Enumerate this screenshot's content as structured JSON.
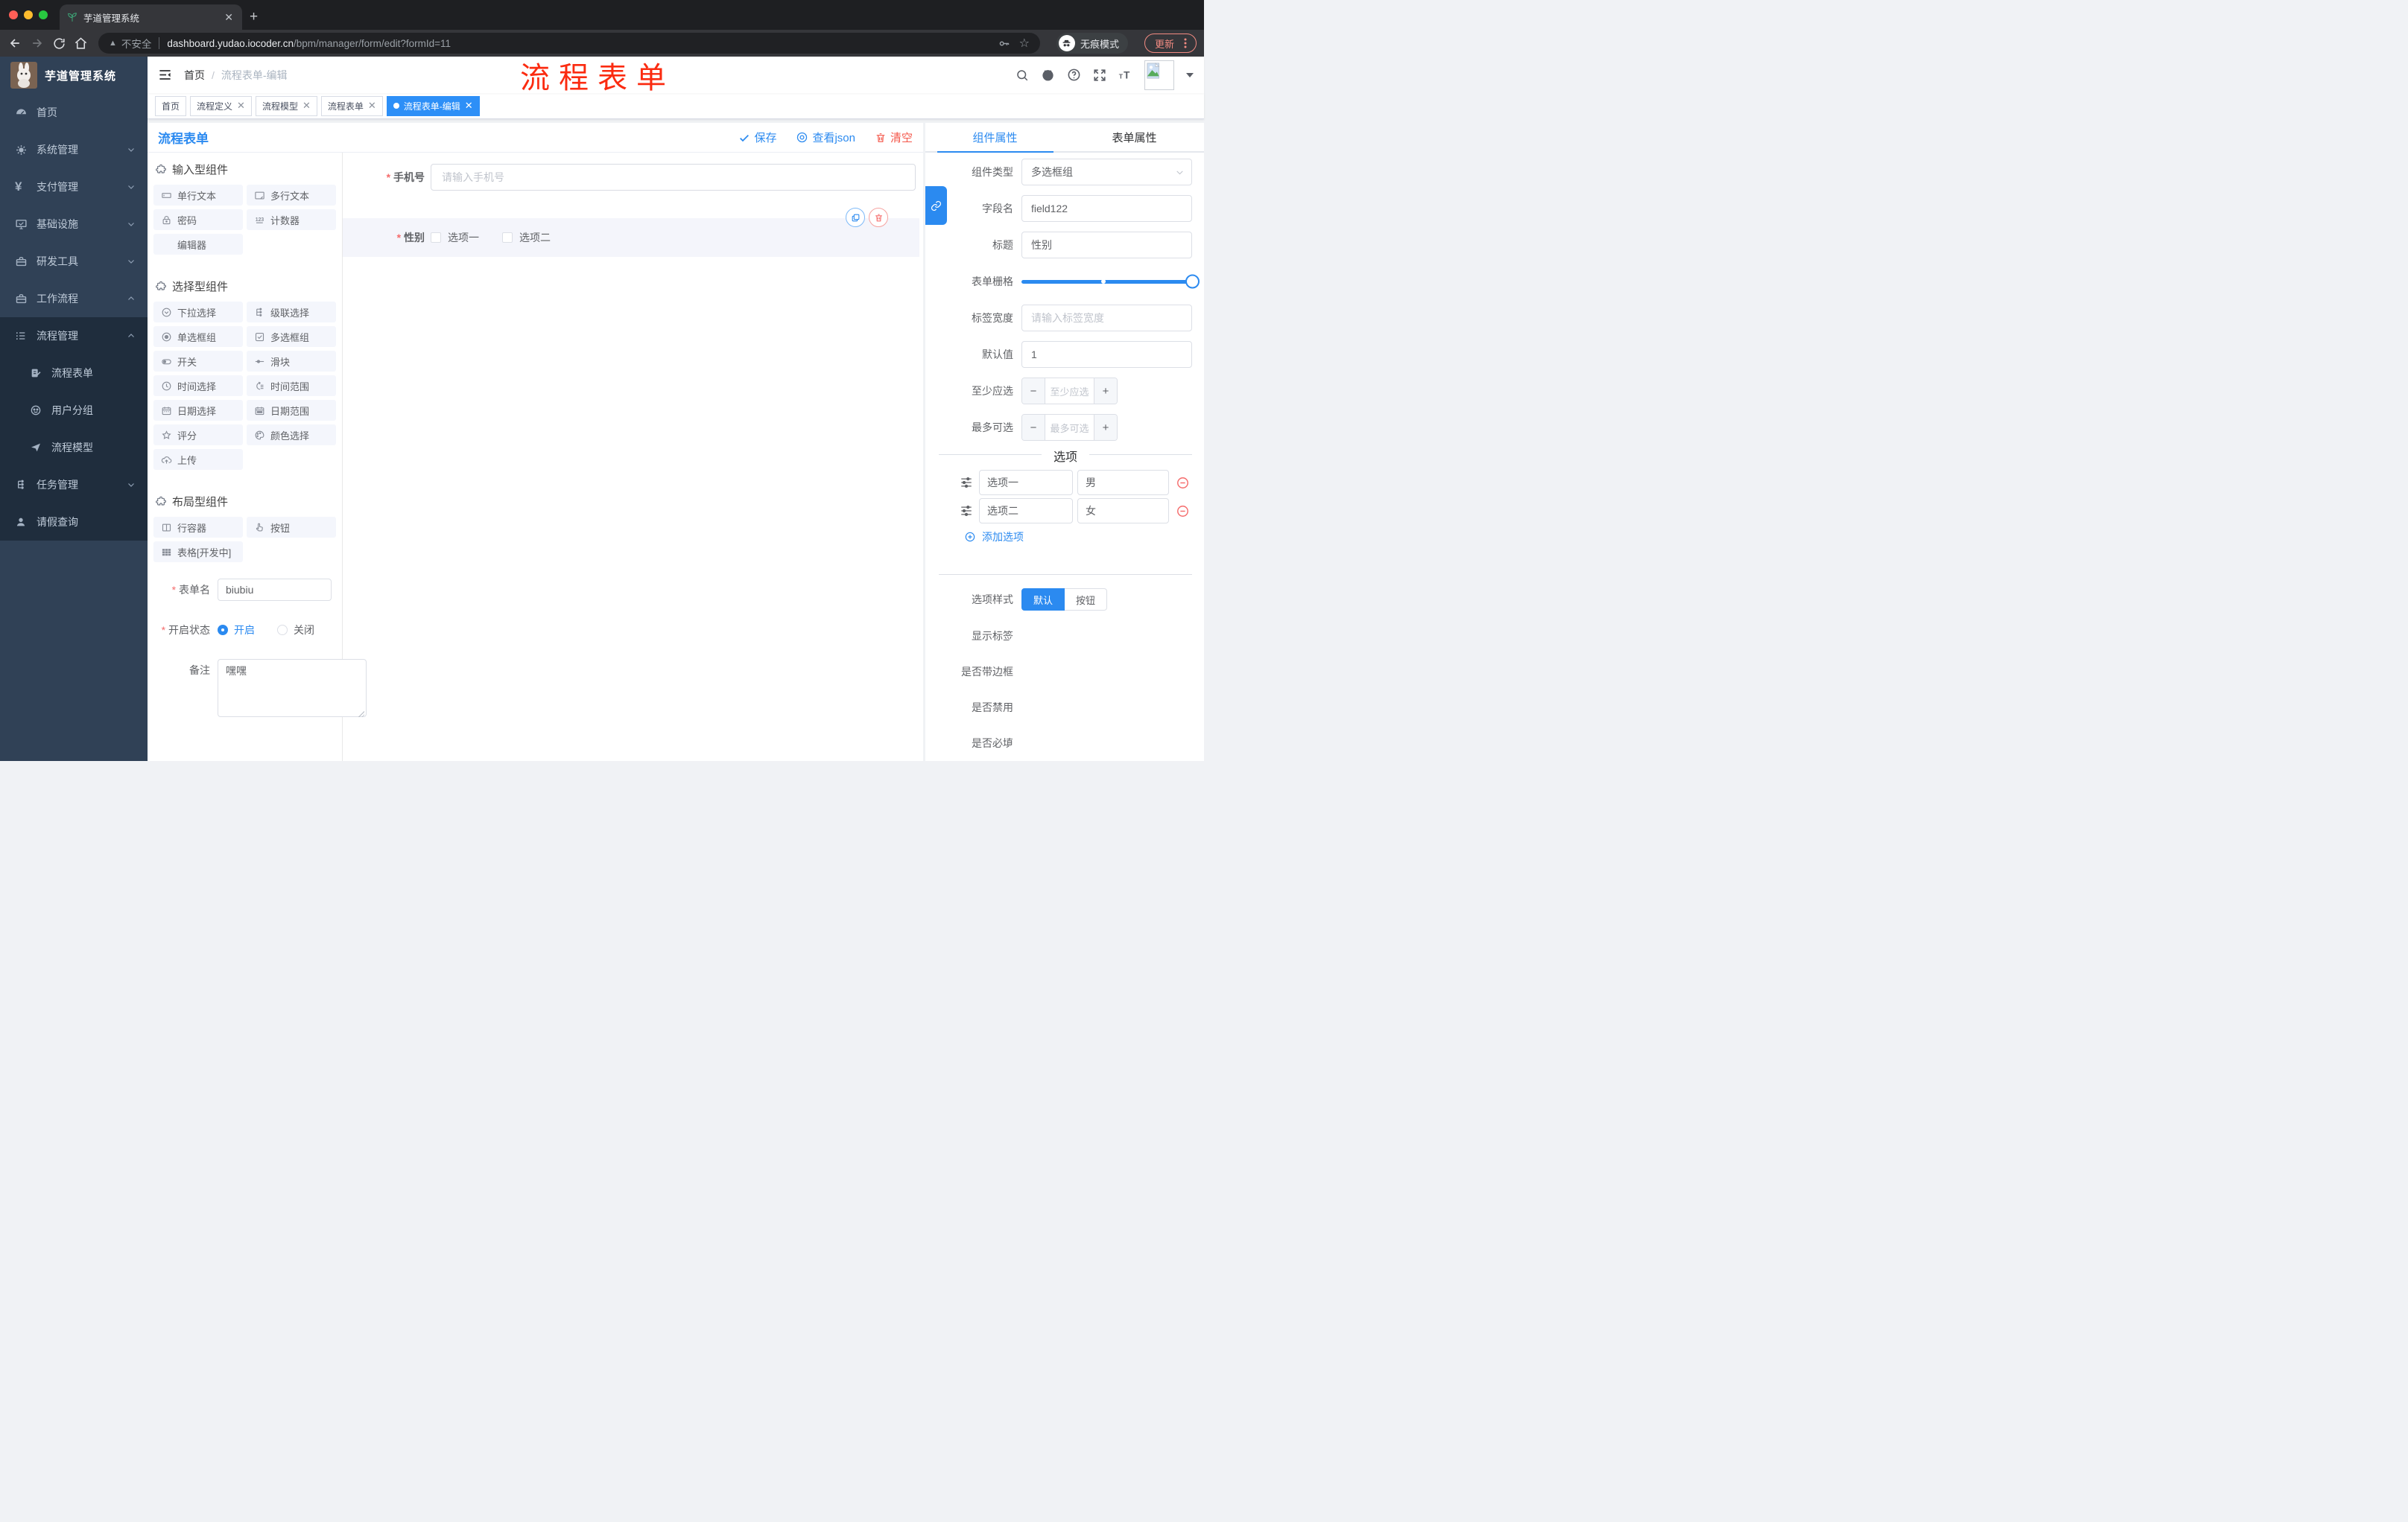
{
  "browser": {
    "tab_title": "芋道管理系统",
    "security_label": "不安全",
    "url_host": "dashboard.yudao.iocoder.cn",
    "url_path": "/bpm/manager/form/edit?formId=11",
    "incognito_label": "无痕模式",
    "update_label": "更新"
  },
  "header": {
    "breadcrumb": {
      "home": "首页",
      "current": "流程表单-编辑"
    },
    "annotation": "流程表单"
  },
  "tags": [
    {
      "label": "首页"
    },
    {
      "label": "流程定义"
    },
    {
      "label": "流程模型"
    },
    {
      "label": "流程表单"
    },
    {
      "label": "流程表单-编辑"
    }
  ],
  "sidebar": {
    "title": "芋道管理系统",
    "items": [
      {
        "label": "首页",
        "icon": "dashboard-icon"
      },
      {
        "label": "系统管理",
        "icon": "gear-icon",
        "state": "collapsed"
      },
      {
        "label": "支付管理",
        "icon": "yen-icon",
        "state": "collapsed"
      },
      {
        "label": "基础设施",
        "icon": "monitor-icon",
        "state": "collapsed"
      },
      {
        "label": "研发工具",
        "icon": "toolbox-icon",
        "state": "collapsed"
      },
      {
        "label": "工作流程",
        "icon": "toolbox-icon",
        "state": "expanded"
      }
    ],
    "submenu": [
      {
        "label": "流程管理",
        "icon": "list-icon",
        "state": "expanded"
      },
      {
        "label": "流程表单",
        "icon": "form-edit-icon"
      },
      {
        "label": "用户分组",
        "icon": "user-group-icon"
      },
      {
        "label": "流程模型",
        "icon": "paper-plane-icon"
      },
      {
        "label": "任务管理",
        "icon": "tree-icon",
        "state": "collapsed"
      },
      {
        "label": "请假查询",
        "icon": "user-icon"
      }
    ]
  },
  "designer": {
    "title": "流程表单",
    "actions": {
      "save": "保存",
      "view_json": "查看json",
      "clear": "清空"
    }
  },
  "palette": {
    "sections": [
      {
        "title": "输入型组件",
        "items": [
          {
            "label": "单行文本",
            "icon": "input-icon"
          },
          {
            "label": "多行文本",
            "icon": "textarea-icon"
          },
          {
            "label": "密码",
            "icon": "lock-icon"
          },
          {
            "label": "计数器",
            "icon": "counter-icon"
          },
          {
            "label": "编辑器",
            "icon": ""
          }
        ]
      },
      {
        "title": "选择型组件",
        "items": [
          {
            "label": "下拉选择",
            "icon": "select-icon"
          },
          {
            "label": "级联选择",
            "icon": "cascade-icon"
          },
          {
            "label": "单选框组",
            "icon": "radio-icon"
          },
          {
            "label": "多选框组",
            "icon": "checkbox-icon"
          },
          {
            "label": "开关",
            "icon": "switch-icon"
          },
          {
            "label": "滑块",
            "icon": "slider-icon"
          },
          {
            "label": "时间选择",
            "icon": "clock-icon"
          },
          {
            "label": "时间范围",
            "icon": "time-range-icon"
          },
          {
            "label": "日期选择",
            "icon": "calendar-icon"
          },
          {
            "label": "日期范围",
            "icon": "calendar-range-icon"
          },
          {
            "label": "评分",
            "icon": "star-icon"
          },
          {
            "label": "颜色选择",
            "icon": "palette-icon"
          },
          {
            "label": "上传",
            "icon": "upload-icon"
          }
        ]
      },
      {
        "title": "布局型组件",
        "items": [
          {
            "label": "行容器",
            "icon": "columns-icon"
          },
          {
            "label": "按钮",
            "icon": "hand-pointer-icon"
          },
          {
            "label": "表格[开发中]",
            "icon": "table-icon"
          }
        ]
      }
    ],
    "form": {
      "form_name": {
        "label": "表单名",
        "value": "biubiu"
      },
      "status": {
        "label": "开启状态",
        "on": "开启",
        "off": "关闭"
      },
      "remark": {
        "label": "备注",
        "value": "嘿嘿"
      }
    }
  },
  "canvas": {
    "phone": {
      "label": "手机号",
      "placeholder": "请输入手机号"
    },
    "gender": {
      "label": "性别",
      "option1": "选项一",
      "option2": "选项二"
    }
  },
  "inspector": {
    "tabs": {
      "component": "组件属性",
      "form": "表单属性"
    },
    "fields": {
      "component_type": {
        "label": "组件类型",
        "value": "多选框组"
      },
      "field_name": {
        "label": "字段名",
        "value": "field122"
      },
      "title": {
        "label": "标题",
        "value": "性别"
      },
      "grid": {
        "label": "表单栅格"
      },
      "label_width": {
        "label": "标签宽度",
        "placeholder": "请输入标签宽度"
      },
      "default_value": {
        "label": "默认值",
        "value": "1"
      },
      "min_select": {
        "label": "至少应选",
        "placeholder": "至少应选"
      },
      "max_select": {
        "label": "最多可选",
        "placeholder": "最多可选"
      }
    },
    "options_divider": "选项",
    "options": [
      {
        "label": "选项一",
        "value": "男"
      },
      {
        "label": "选项二",
        "value": "女"
      }
    ],
    "add_option": "添加选项",
    "option_style": {
      "label": "选项样式",
      "default": "默认",
      "button": "按钮"
    },
    "switches": [
      {
        "label": "显示标签",
        "on": true
      },
      {
        "label": "是否带边框",
        "on": false
      },
      {
        "label": "是否禁用",
        "on": false
      },
      {
        "label": "是否必填",
        "on": true
      }
    ]
  }
}
